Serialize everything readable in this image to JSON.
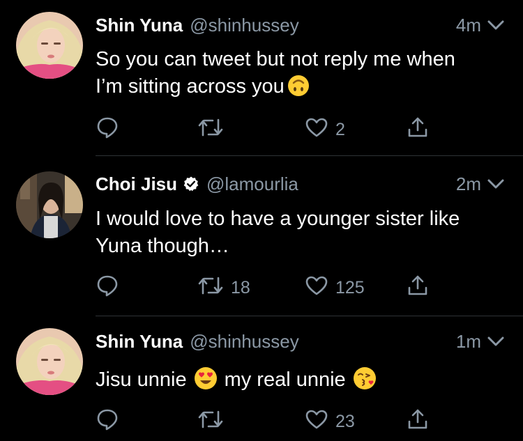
{
  "tweets": [
    {
      "author": "Shin Yuna",
      "handle": "@shinhussey",
      "verified": false,
      "time": "4m",
      "text_line1": "So you can tweet but not reply me when",
      "text_line2": "I’m sitting across you",
      "emoji": "upside-down-face",
      "retweets": "",
      "likes": "2"
    },
    {
      "author": "Choi Jisu",
      "handle": "@lamourlia",
      "verified": true,
      "time": "2m",
      "text_line1": "I would love to have a younger sister like",
      "text_line2": "Yuna though…",
      "retweets": "18",
      "likes": "125"
    },
    {
      "author": "Shin Yuna",
      "handle": "@shinhussey",
      "verified": false,
      "time": "1m",
      "text_part1": "Jisu unnie",
      "emoji1": "heart-eyes-face",
      "text_part2": "my real unnie",
      "emoji2": "face-blowing-kiss",
      "retweets": "",
      "likes": "23"
    }
  ],
  "theme": {
    "background": "#000000",
    "text": "#ffffff",
    "secondary": "#8b98a5",
    "divider": "#2f3336"
  }
}
